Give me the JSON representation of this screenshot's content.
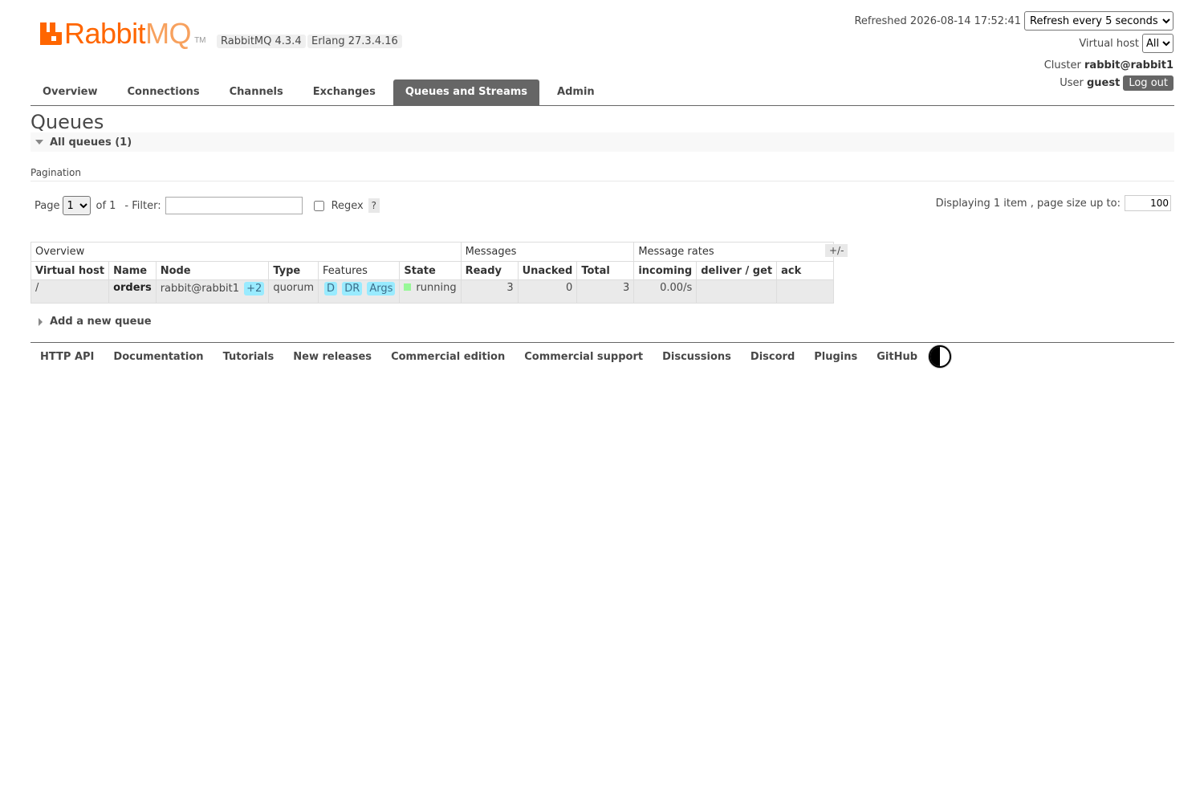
{
  "header": {
    "logo_text_main": "Rabbit",
    "logo_text_mq": "MQ",
    "logo_tm": "TM",
    "version_rabbit": "RabbitMQ 4.3.4",
    "version_erlang": "Erlang 27.3.4.16",
    "refreshed_text": "Refreshed 2026-08-14 17:52:41",
    "refresh_select": "Refresh every 5 seconds",
    "vhost_label": "Virtual host",
    "vhost_select": "All",
    "cluster_label": "Cluster",
    "cluster_value": "rabbit@rabbit1",
    "user_label": "User",
    "user_value": "guest",
    "logout_label": "Log out"
  },
  "nav": {
    "tabs": [
      "Overview",
      "Connections",
      "Channels",
      "Exchanges",
      "Queues and Streams",
      "Admin"
    ],
    "active": "Queues and Streams"
  },
  "main": {
    "title": "Queues",
    "section_label": "All queues (1)",
    "pagination_label": "Pagination",
    "page_label": "Page",
    "page_value": "1",
    "of_label": "of 1",
    "filter_label": "- Filter:",
    "filter_value": "",
    "regex_label": "Regex",
    "help_label": "?",
    "display_text": "Displaying 1 item , page size up to:",
    "page_size": "100"
  },
  "table": {
    "groups": [
      "Overview",
      "Messages",
      "Message rates"
    ],
    "columns": [
      "Virtual host",
      "Name",
      "Node",
      "Type",
      "Features",
      "State",
      "Ready",
      "Unacked",
      "Total",
      "incoming",
      "deliver / get",
      "ack"
    ],
    "plus_minus": "+/-",
    "rows": [
      {
        "vhost": "/",
        "name": "orders",
        "node": "rabbit@rabbit1",
        "node_extra": "+2",
        "type": "quorum",
        "features": [
          "D",
          "DR",
          "Args"
        ],
        "state": "running",
        "ready": "3",
        "unacked": "0",
        "total": "3",
        "incoming": "0.00/s",
        "deliver_get": "",
        "ack": ""
      }
    ]
  },
  "add_queue_label": "Add a new queue",
  "footer": {
    "links": [
      "HTTP API",
      "Documentation",
      "Tutorials",
      "New releases",
      "Commercial edition",
      "Commercial support",
      "Discussions",
      "Discord",
      "Plugins",
      "GitHub"
    ],
    "theme_icon": "contrast-icon"
  },
  "colors": {
    "brand": "#ff6600",
    "tab_active": "#666666",
    "feature_pill": "#99ebff",
    "state_running": "#98f898"
  }
}
